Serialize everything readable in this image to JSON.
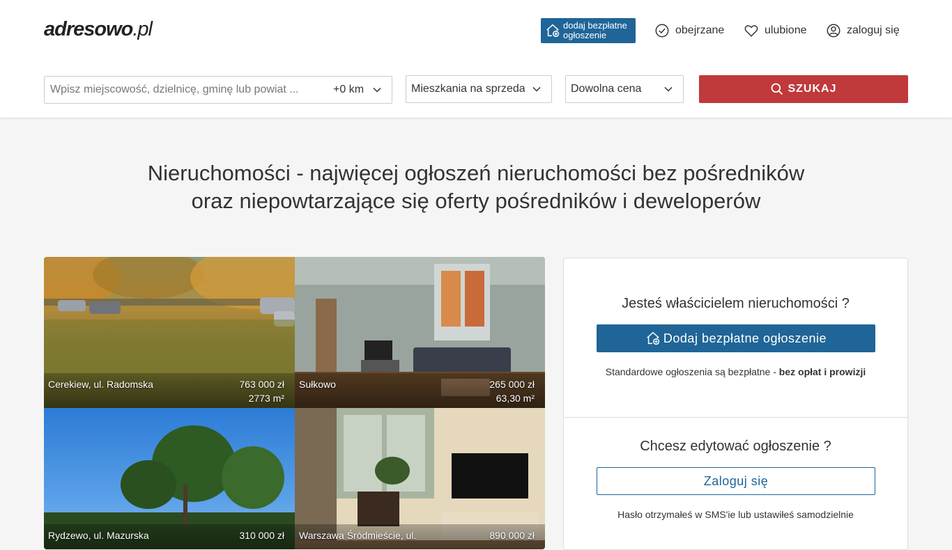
{
  "header": {
    "logo_main": "adresowo",
    "logo_tld": ".pl",
    "add_button_line1": "dodaj bezpłatne",
    "add_button_line2": "ogłoszenie",
    "watched": "obejrzane",
    "favorites": "ulubione",
    "login": "zaloguj się"
  },
  "search": {
    "placeholder": "Wpisz miejscowość, dzielnicę, gminę lub powiat ...",
    "radius": "+0 km",
    "type_selected": "Mieszkania na sprzedaż",
    "price_selected": "Dowolna cena",
    "button": "SZUKAJ"
  },
  "headline": {
    "line1": "Nieruchomości - najwięcej ogłoszeń nieruchomości bez pośredników",
    "line2": "oraz niepowtarzające się oferty pośredników i deweloperów"
  },
  "listings": [
    {
      "location": "Cerekiew, ul. Radomska",
      "price": "763 000 zł",
      "area": "2773 m²"
    },
    {
      "location": "Sułkowo",
      "price": "265 000 zł",
      "area": "63,30 m²"
    },
    {
      "location": "Rydzewo, ul. Mazurska",
      "price": "310 000 zł",
      "area": ""
    },
    {
      "location": "Warszawa Śródmieście, ul.",
      "price": "890 000 zł",
      "area": ""
    }
  ],
  "panel": {
    "owner_question": "Jesteś właścicielem nieruchomości ?",
    "add_listing_button": "Dodaj bezpłatne ogłoszenie",
    "free_note": "Standardowe ogłoszenia są bezpłatne - ",
    "free_note_bold": "bez opłat i prowizji",
    "edit_question": "Chcesz edytować ogłoszenie ?",
    "login_button": "Zaloguj się",
    "password_note": "Hasło otrzymałeś w SMS'ie lub ustawiłeś samodzielnie"
  },
  "colors": {
    "primary_blue": "#1f6597",
    "search_red": "#c0393b",
    "background": "#f5f5f5"
  },
  "icons": [
    "house-plus-icon",
    "check-circle-icon",
    "heart-icon",
    "user-circle-icon",
    "chevron-down-icon",
    "search-icon"
  ]
}
